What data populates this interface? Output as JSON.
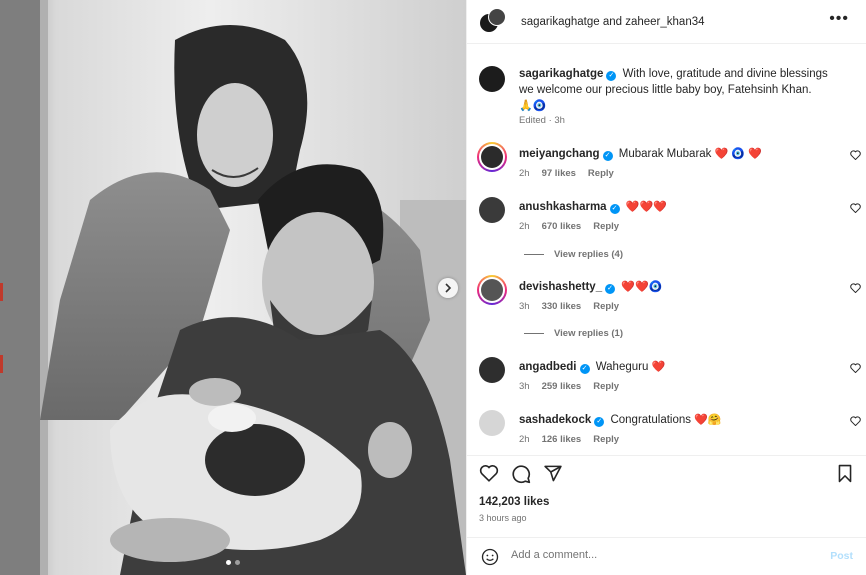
{
  "post": {
    "header_title": "sagarikaghatge and zaheer_khan34",
    "more_label": "•••",
    "caption": {
      "username": "sagarikaghatge",
      "text": "With love, gratitude and divine blessings we welcome our precious little baby boy, Fatehsinh Khan.",
      "emojis": "🙏🧿",
      "meta": "Edited · 3h"
    },
    "comments": [
      {
        "username": "meiyangchang",
        "text": "Mubarak Mubarak",
        "emojis": "❤️ 🧿 ❤️",
        "time": "2h",
        "likes": "97 likes",
        "reply": "Reply",
        "view_replies": ""
      },
      {
        "username": "anushkasharma",
        "text": "",
        "emojis": "❤️❤️❤️",
        "time": "2h",
        "likes": "670 likes",
        "reply": "Reply",
        "view_replies": "View replies (4)"
      },
      {
        "username": "devishashetty_",
        "text": "",
        "emojis": "❤️❤️🧿",
        "time": "3h",
        "likes": "330 likes",
        "reply": "Reply",
        "view_replies": "View replies (1)"
      },
      {
        "username": "angadbedi",
        "text": "Waheguru",
        "emojis": "❤️",
        "time": "3h",
        "likes": "259 likes",
        "reply": "Reply",
        "view_replies": ""
      },
      {
        "username": "sashadekock",
        "text": "Congratulations",
        "emojis": "❤️🤗",
        "time": "2h",
        "likes": "126 likes",
        "reply": "Reply",
        "view_replies": ""
      }
    ],
    "likes_count": "142,203 likes",
    "time_ago": "3 hours ago",
    "comment_placeholder": "Add a comment...",
    "post_label": "Post"
  },
  "icons": [
    "heart-icon",
    "comment-icon",
    "share-icon",
    "bookmark-icon",
    "emoji-icon",
    "chevron-right-icon",
    "verified-icon"
  ],
  "colors": {
    "accent_blue": "#0095f6",
    "post_disabled": "#b2dffc",
    "heart_red": "#e0245e",
    "text": "#262626",
    "muted": "#737373"
  }
}
